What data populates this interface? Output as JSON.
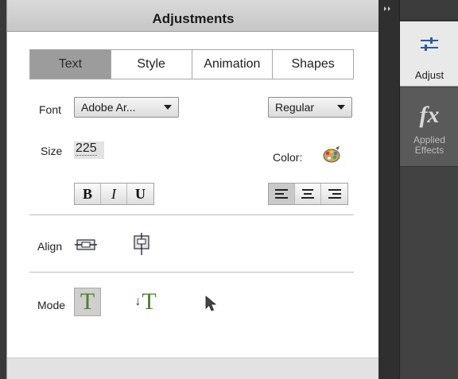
{
  "panel": {
    "title": "Adjustments",
    "tabs": [
      {
        "label": "Text",
        "active": true
      },
      {
        "label": "Style",
        "active": false
      },
      {
        "label": "Animation",
        "active": false
      },
      {
        "label": "Shapes",
        "active": false
      }
    ],
    "font_label": "Font",
    "font_value": "Adobe Ar...",
    "font_style_value": "Regular",
    "size_label": "Size",
    "size_value": "225",
    "color_label": "Color:",
    "style_buttons": [
      "B",
      "I",
      "U"
    ],
    "align_label": "Align",
    "mode_label": "Mode",
    "text_align_active": "left",
    "mode_glyph": "T",
    "mode_vertical_prefix": "↓"
  },
  "dock": {
    "adjust_label": "Adjust",
    "fx_glyph": "fx",
    "applied_effects_label": "Applied\nEffects"
  },
  "icons": {
    "collapse": "double-chevron-right",
    "palette": "color-palette",
    "align_h": "align-horizontal-center",
    "align_v": "align-vertical-center",
    "mode_horizontal": "horizontal-type-tool",
    "mode_vertical": "vertical-type-tool",
    "mode_select": "selection-arrow"
  },
  "colors": {
    "mode_t_green": "#4f7f2a",
    "active_tab": "#9c9c9c"
  }
}
